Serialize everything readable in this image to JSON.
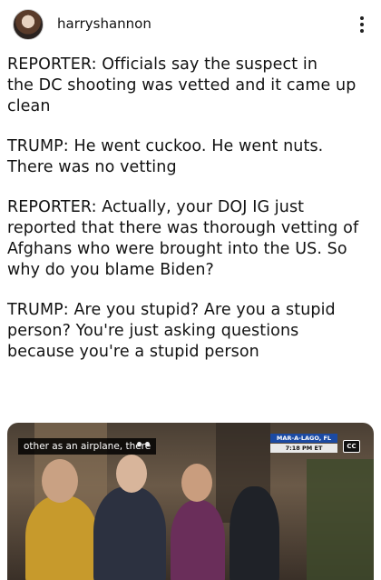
{
  "header": {
    "username": "harryshannon"
  },
  "post": {
    "paragraphs": [
      "REPORTER: Officials say the suspect in\nthe DC shooting was vetted and it came up\nclean",
      "TRUMP: He went cuckoo. He went nuts.\nThere was no vetting",
      "REPORTER: Actually, your DOJ IG just\nreported that there was thorough vetting of\nAfghans who were brought into the US. So\nwhy do you blame Biden?",
      "TRUMP: Are you stupid? Are you a stupid\nperson? You're just asking questions\nbecause you're a stupid person"
    ]
  },
  "video": {
    "caption": "other as an airplane, there",
    "location": "MAR-A-LAGO, FL",
    "time": "7:18 PM ET",
    "cc_label": "CC"
  },
  "icons": {
    "more": "more-vertical-icon",
    "cc": "closed-captions-icon"
  }
}
